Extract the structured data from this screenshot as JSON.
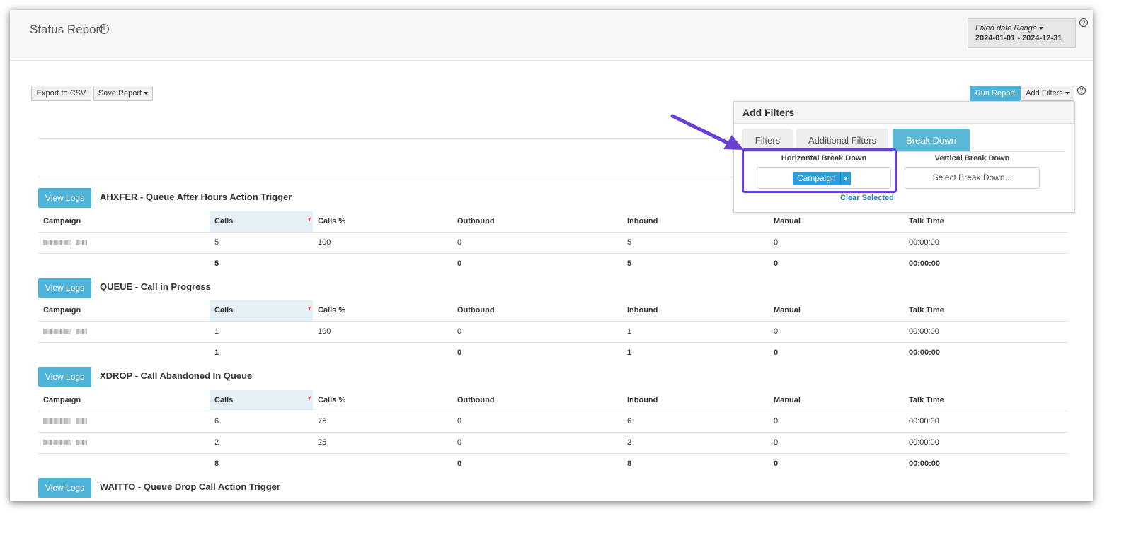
{
  "header": {
    "title": "Status Report",
    "date_range_label": "Fixed date Range",
    "date_range_value": "2024-01-01 - 2024-12-31"
  },
  "toolbar": {
    "export_label": "Export to CSV",
    "save_label": "Save Report",
    "run_label": "Run Report",
    "add_filters_label": "Add Filters"
  },
  "filters_panel": {
    "title": "Add Filters",
    "tabs": [
      "Filters",
      "Additional Filters",
      "Break Down"
    ],
    "active_tab": "Break Down",
    "horizontal_label": "Horizontal Break Down",
    "horizontal_selected": "Campaign",
    "vertical_label": "Vertical Break Down",
    "vertical_placeholder": "Select Break Down...",
    "clear_label": "Clear Selected"
  },
  "columns": [
    "Campaign",
    "Calls",
    "Calls %",
    "Outbound",
    "Inbound",
    "Manual",
    "Talk Time"
  ],
  "view_logs_label": "View Logs",
  "sections": [
    {
      "title": "AHXFER - Queue After Hours Action Trigger",
      "rows": [
        [
          "",
          "5",
          "100",
          "0",
          "5",
          "0",
          "00:00:00"
        ]
      ],
      "totals": [
        "",
        "5",
        "",
        "0",
        "5",
        "0",
        "00:00:00"
      ]
    },
    {
      "title": "QUEUE - Call in Progress",
      "rows": [
        [
          "",
          "1",
          "100",
          "0",
          "1",
          "0",
          "00:00:00"
        ]
      ],
      "totals": [
        "",
        "1",
        "",
        "0",
        "1",
        "0",
        "00:00:00"
      ]
    },
    {
      "title": "XDROP - Call Abandoned In Queue",
      "rows": [
        [
          "",
          "6",
          "75",
          "0",
          "6",
          "0",
          "00:00:00"
        ],
        [
          "",
          "2",
          "25",
          "0",
          "2",
          "0",
          "00:00:00"
        ]
      ],
      "totals": [
        "",
        "8",
        "",
        "0",
        "8",
        "0",
        "00:00:00"
      ]
    },
    {
      "title": "WAITTO - Queue Drop Call Action Trigger",
      "rows": [],
      "totals": []
    }
  ],
  "colors": {
    "accent": "#4fb3d8",
    "chip": "#2a9fe0",
    "highlight": "#6a3fd6",
    "sort_marker": "#e53d3d"
  }
}
